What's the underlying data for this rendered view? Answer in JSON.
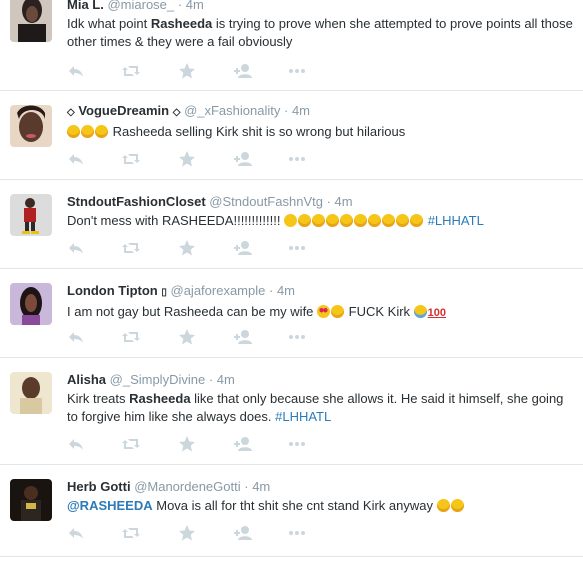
{
  "tweets": [
    {
      "name": "Mia L.",
      "handle": "@miarose_",
      "time": "4m",
      "text_pre": "Idk what point ",
      "text_bold": "Rasheeda",
      "text_post": " is trying to prove when she attempted to prove points all those other times & they were a fail obviously"
    },
    {
      "name": "VogueDreamin",
      "name_prefix": "◇",
      "name_suffix": "◇",
      "handle": "@_xFashionality",
      "time": "4m",
      "text": "Rasheeda selling Kirk shit is so wrong but hilarious"
    },
    {
      "name": "StndoutFashionCloset",
      "handle": "@StndoutFashnVtg",
      "time": "4m",
      "text": "Don't mess with RASHEEDA!!!!!!!!!!!!!",
      "hashtag": "#LHHATL"
    },
    {
      "name": "London Tipton",
      "name_suffix": "▯",
      "handle": "@ajaforexample",
      "time": "4m",
      "text_pre": "I am not gay but Rasheeda can be my wife",
      "text_mid": " FUCK Kirk ",
      "emoji_100": "100"
    },
    {
      "name": "Alisha",
      "handle": "@_SimplyDivine",
      "time": "4m",
      "text_pre": "Kirk treats ",
      "text_bold": "Rasheeda",
      "text_post": " like that only because she allows it. He said it himself, she going to forgive him like she always does.",
      "hashtag": "#LHHATL"
    },
    {
      "name": "Herb Gotti",
      "handle": "@ManordeneGotti",
      "time": "4m",
      "mention": "@RASHEEDA",
      "text": " Mova is all for tht shit she cnt stand Kirk anyway"
    }
  ],
  "separator": "·",
  "icons": [
    "reply-icon",
    "retweet-icon",
    "favorite-icon",
    "follow-icon",
    "more-icon"
  ]
}
